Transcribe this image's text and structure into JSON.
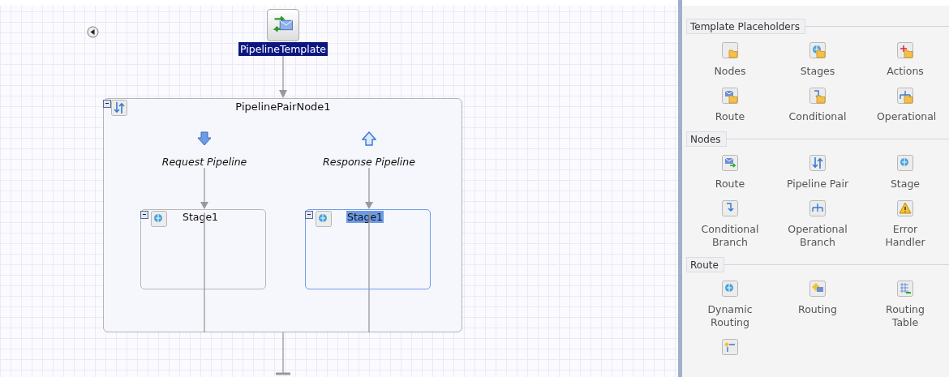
{
  "canvas": {
    "start_node": {
      "label": "PipelineTemplate",
      "selected": true
    },
    "pair_node": {
      "title": "PipelinePairNode1",
      "pipelines": [
        {
          "kind": "request",
          "label": "Request Pipeline",
          "stage": {
            "label": "Stage1",
            "selected": false
          }
        },
        {
          "kind": "response",
          "label": "Response Pipeline",
          "stage": {
            "label": "Stage1",
            "selected": true
          }
        }
      ]
    }
  },
  "palette": {
    "sections": [
      {
        "title": "Template Placeholders",
        "items": [
          {
            "kind": "tool",
            "label": "Nodes"
          },
          {
            "kind": "tool",
            "label": "Stages"
          },
          {
            "kind": "tool",
            "label": "Actions"
          },
          {
            "kind": "tool",
            "label": "Route"
          },
          {
            "kind": "tool",
            "label": "Conditional"
          },
          {
            "kind": "tool",
            "label": "Operational"
          }
        ]
      },
      {
        "title": "Nodes",
        "items": [
          {
            "kind": "tool",
            "label": "Route"
          },
          {
            "kind": "tool",
            "label": "Pipeline Pair"
          },
          {
            "kind": "tool",
            "label": "Stage"
          },
          {
            "kind": "tool",
            "label": "Conditional Branch"
          },
          {
            "kind": "tool",
            "label": "Operational Branch"
          },
          {
            "kind": "tool",
            "label": "Error Handler"
          }
        ]
      },
      {
        "title": "Route",
        "items": [
          {
            "kind": "tool",
            "label": "Dynamic Routing"
          },
          {
            "kind": "tool",
            "label": "Routing"
          },
          {
            "kind": "tool",
            "label": "Routing Table"
          },
          {
            "kind": "icon-only"
          }
        ]
      }
    ]
  }
}
